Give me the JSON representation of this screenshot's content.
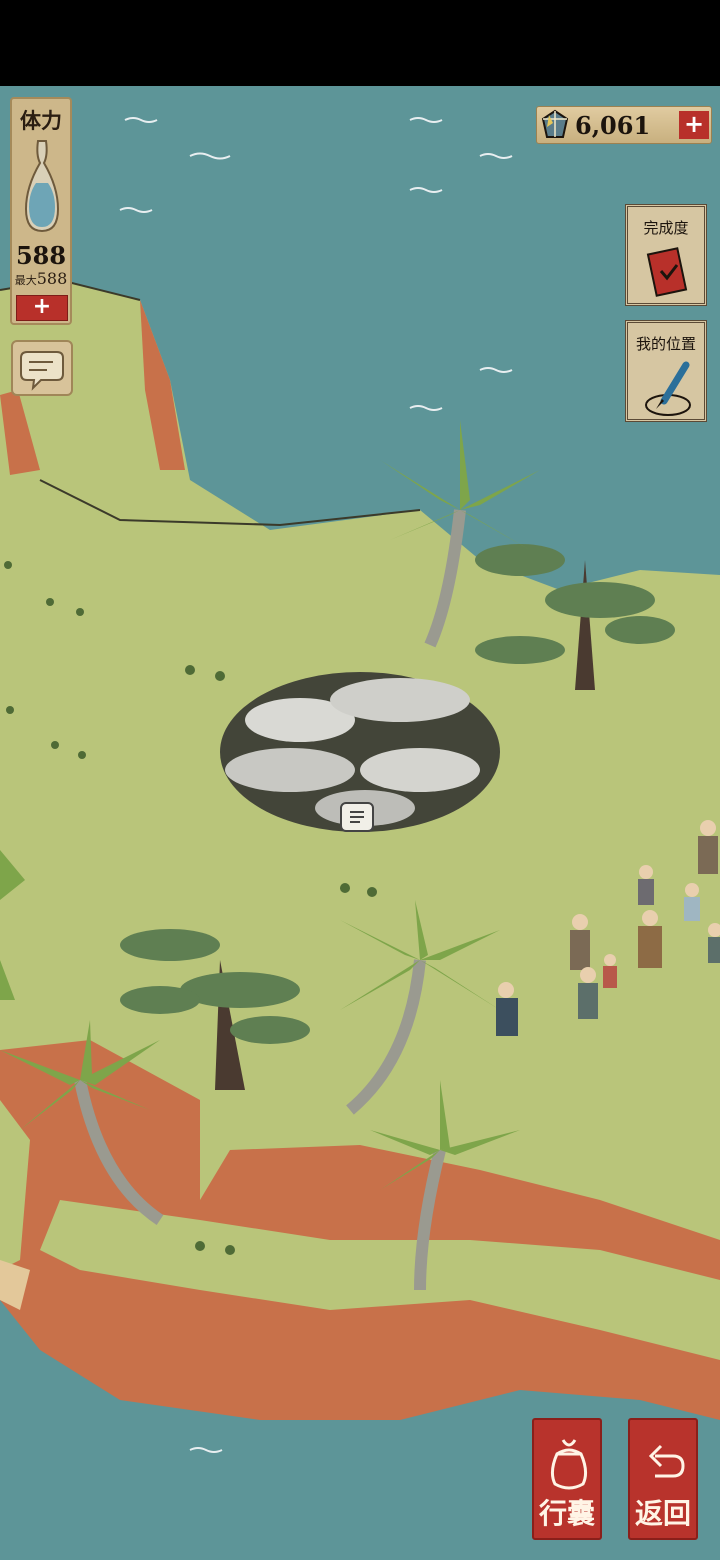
{
  "stamina": {
    "title": "体力",
    "value": "588",
    "max_label": "最大",
    "max_value": "588",
    "add_label": "+"
  },
  "currency": {
    "value": "6,061",
    "add_label": "+"
  },
  "side_buttons": {
    "completion_label": "完成度",
    "my_location_label": "我的位置"
  },
  "bottom_buttons": {
    "bag_label": "行囊",
    "back_label": "返回"
  },
  "icons": {
    "gourd": "gourd-icon",
    "chat": "chat-bubble-icon",
    "gem": "gem-icon",
    "book": "completion-book-icon",
    "brush": "brush-location-icon",
    "bundle": "bundle-icon",
    "back": "back-arrow-icon"
  },
  "colors": {
    "sea": "#5d9598",
    "grass": "#b9c57a",
    "cliff": "#c8714a",
    "accent_red": "#b8302a",
    "panel": "#d6c6a2"
  }
}
